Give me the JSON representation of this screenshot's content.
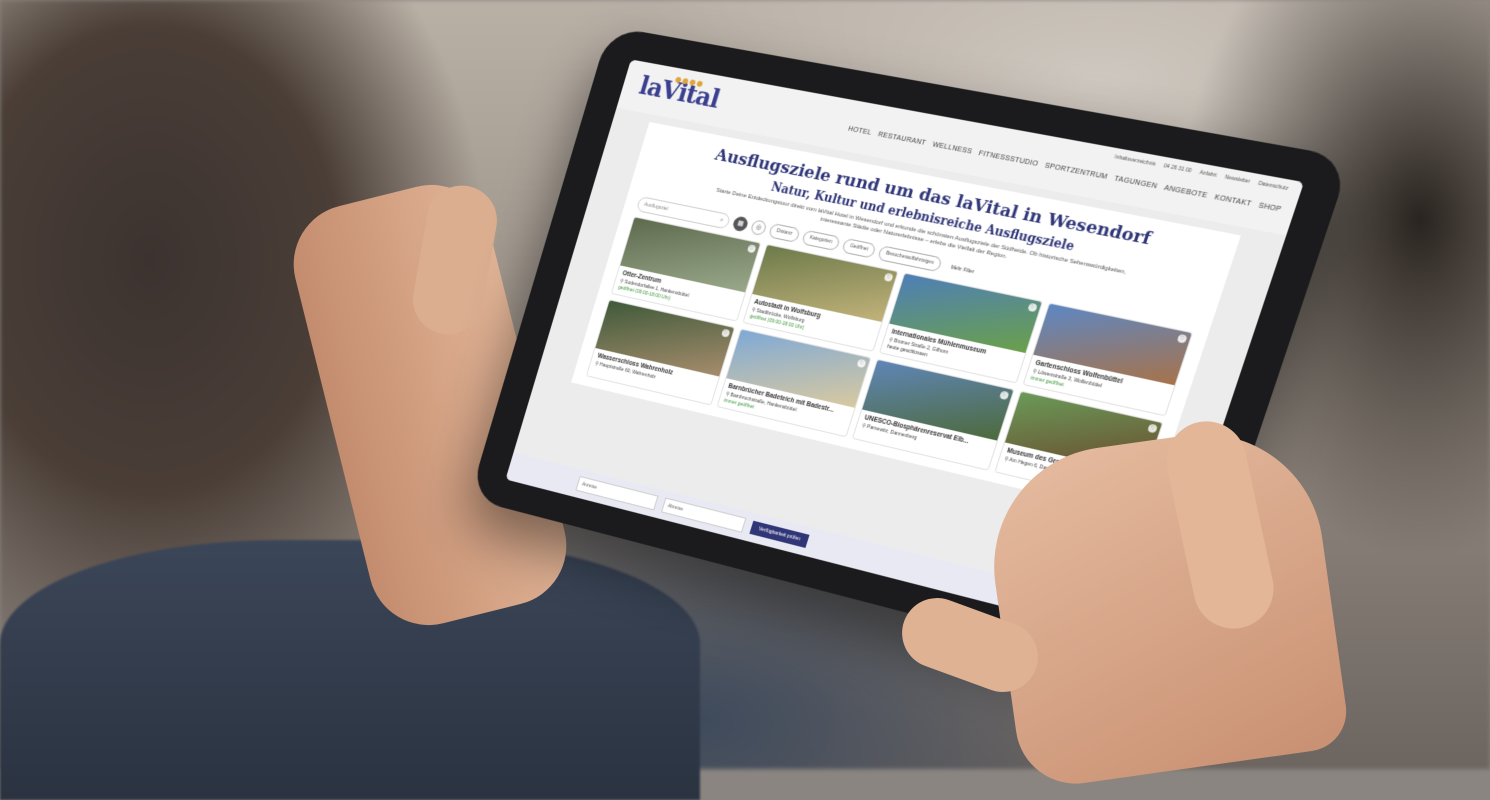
{
  "header": {
    "logo": "laVital",
    "logo_dots": "●●●●",
    "top_links": [
      "Inhaltsverzeichnis",
      "04 26 31 00",
      "Anfahrt",
      "Newsletter",
      "Datenschutz"
    ],
    "nav": [
      "HOTEL",
      "RESTAURANT",
      "WELLNESS",
      "FITNESSSTUDIO",
      "SPORTZENTRUM",
      "TAGUNGEN",
      "ANGEBOTE",
      "KONTAKT",
      "SHOP"
    ]
  },
  "page": {
    "title": "Ausflugsziele rund um das laVital in Wesendorf",
    "subtitle": "Natur, Kultur und erlebnisreiche Ausflugsziele",
    "intro": "Starte Deine Entdeckungstour direkt vom laVital Hotel in Wesendorf und erkunde die schönsten Ausflugsziele der Südheide. Ob historische Sehenswürdigkeiten, interessante Städte oder Naturerlebnisse – erlebe die Vielfalt der Region."
  },
  "filters": {
    "search_placeholder": "Ausflugsziel",
    "pills": [
      "Distanz",
      "Kategorien",
      "Geöffnet",
      "Besucherauffahrtsiges"
    ],
    "more": "Mehr Filter"
  },
  "cards": [
    {
      "title": "Otter-Zentrum",
      "addr": "Sudendorfallee 1, Hankensbüttel",
      "status": "geöffnet (09:00-18:00 Uhr)",
      "c1": "#5d6a4e",
      "c2": "#9aa88a"
    },
    {
      "title": "Autostadt in Wolfsburg",
      "addr": "Stadtbrücke, Wolfsburg",
      "status": "geöffnet (09:00-18:00 Uhr)",
      "c1": "#6c7a4a",
      "c2": "#c2b27a"
    },
    {
      "title": "Internationales Mühlenmuseum",
      "addr": "Bromer Straße 2, Gifhorn",
      "status": "heute geschlossen",
      "c1": "#4e7fb8",
      "c2": "#6aa04a"
    },
    {
      "title": "Gartenschloss Wolfenbüttel",
      "addr": "Löwenstraße 3, Wolfenbüttel",
      "status": "immer geöffnet",
      "c1": "#5d87c4",
      "c2": "#a7734a"
    },
    {
      "title": "Wasserschloss Wahrenholz",
      "addr": "Hauptstraße 60, Wahrenholz",
      "status": "",
      "c1": "#3f5a3a",
      "c2": "#a58c6c"
    },
    {
      "title": "Barnbrücher Badeteich mit Badestr...",
      "addr": "Barnbruchstraße, Hankensbüttel",
      "status": "immer geöffnet",
      "c1": "#7fa9d6",
      "c2": "#d8c9a0"
    },
    {
      "title": "UNESCO-Biosphärenreservat Elb...",
      "addr": "Parnewitz, Dannenberg",
      "status": "",
      "c1": "#5f86b8",
      "c2": "#4d6a3c"
    },
    {
      "title": "Museum des Großen Moor",
      "addr": "Am Hegen 6, Dannenberg (Elbe)",
      "status": "",
      "c1": "#6a9a58",
      "c2": "#6b4a2e"
    }
  ],
  "bottom_bar": {
    "field1": "Anreise",
    "field2": "Abreise",
    "button": "Verfügbarkeit prüfen"
  }
}
